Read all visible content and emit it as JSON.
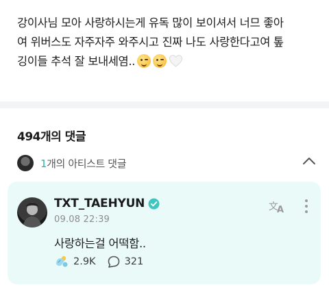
{
  "post": {
    "lines": [
      "강이사님 모아 사랑하시는게 유독 많이 보이셔서 너므 좋아",
      "여 위버스도 자주자주 와주시고 진짜 나도 사랑한다고여 톺",
      "깅이들 추석 잘 보내세염.."
    ],
    "emojis": [
      "winking-face",
      "winking-face",
      "white-heart"
    ]
  },
  "comments": {
    "count_label": "494개의 댓글",
    "artist_row": {
      "count": "1",
      "label": "개의 아티스트 댓글",
      "expanded": true
    },
    "artist_comment": {
      "author": "TXT_TAEHYUN",
      "verified": true,
      "timestamp": "09.08 22:39",
      "text": "사랑하는걸 어떡함..",
      "likes": "2.9K",
      "replies": "321"
    }
  },
  "colors": {
    "accent": "#1fb5b0",
    "card_background": "#eafaf8",
    "verified_badge": "#3fc6c0"
  }
}
